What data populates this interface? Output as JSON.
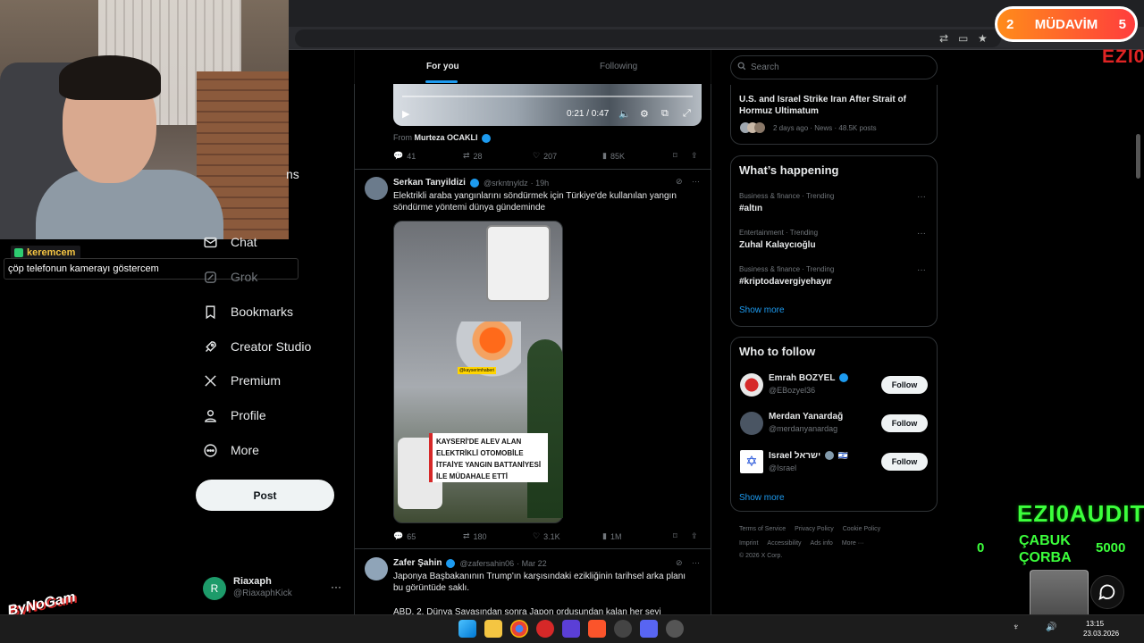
{
  "nav": {
    "partial_label": "ns",
    "items": [
      {
        "label": "Chat",
        "icon": "mail-icon",
        "muted": false
      },
      {
        "label": "Grok",
        "icon": "grok-icon",
        "muted": true
      },
      {
        "label": "Bookmarks",
        "icon": "bookmark-icon",
        "muted": false
      },
      {
        "label": "Creator Studio",
        "icon": "rocket-icon",
        "muted": false
      },
      {
        "label": "Premium",
        "icon": "x-logo-icon",
        "muted": false
      },
      {
        "label": "Profile",
        "icon": "person-icon",
        "muted": false
      },
      {
        "label": "More",
        "icon": "more-circle-icon",
        "muted": false
      }
    ],
    "post_button": "Post",
    "account": {
      "initial": "R",
      "name": "Riaxaph",
      "handle": "@RiaxaphKick",
      "more": "···"
    }
  },
  "chat_overlay": {
    "username": "keremcem",
    "message": "çöp telefonun kamerayı göstercem"
  },
  "feed": {
    "tabs": {
      "for_you": "For you",
      "following": "Following"
    },
    "video": {
      "time": "0:21 / 0:47"
    },
    "prev_tweet": {
      "from_label": "From",
      "from_name": "Murteza OCAKLI",
      "replies": "41",
      "reposts": "28",
      "likes": "207",
      "views": "85K"
    },
    "tweet1": {
      "name": "Serkan Tanyildizi",
      "handle": "@srkntnyldz",
      "time": "· 19h",
      "text": "Elektrikli araba yangınlarını söndürmek için Türkiye'de kullanılan yangın söndürme yöntemi dünya gündeminde",
      "media_tag": "@kayserimhaberi",
      "caption": [
        "KAYSERİ'DE ALEV ALAN",
        "ELEKTRİKLİ OTOMOBİLE",
        "İTFAİYE YANGIN BATTANİYESİ",
        "İLE MÜDAHALE ETTİ"
      ],
      "replies": "65",
      "reposts": "180",
      "likes": "3.1K",
      "views": "1M"
    },
    "tweet2": {
      "name": "Zafer Şahin",
      "handle": "@zafersahin06",
      "time": "· Mar 22",
      "text": "Japonya Başbakanının Trump'ın karşısındaki ezikliğinin tarihsel arka planı bu görüntüde saklı.",
      "text2": "ABD, 2. Dünya Savaşından sonra Japon ordusundan kalan her şeyi"
    }
  },
  "right": {
    "search_placeholder": "Search",
    "news": {
      "title": "U.S. and Israel Strike Iran After Strait of Hormuz Ultimatum",
      "meta": "2 days ago · News · 48.5K posts"
    },
    "happening": {
      "title": "What’s happening",
      "trends": [
        {
          "meta": "Business & finance · Trending",
          "name": "#altın"
        },
        {
          "meta": "Entertainment · Trending",
          "name": "Zuhal Kalaycıoğlu"
        },
        {
          "meta": "Business & finance · Trending",
          "name": "#kriptodavergiyehayır"
        }
      ],
      "more_dots": "···",
      "show_more": "Show more"
    },
    "follow": {
      "title": "Who to follow",
      "users": [
        {
          "name": "Emrah BOZYEL",
          "handle": "@EBozyel36",
          "button": "Follow"
        },
        {
          "name": "Merdan Yanardağ",
          "handle": "@merdanyanardag",
          "button": "Follow"
        },
        {
          "name": "Israel ישראל",
          "handle": "@Israel",
          "button": "Follow"
        }
      ],
      "show_more": "Show more"
    },
    "footer": {
      "row1": [
        "Terms of Service",
        "Privacy Policy",
        "Cookie Policy"
      ],
      "row2": [
        "Imprint",
        "Accessibility",
        "Ads info",
        "More ···"
      ],
      "copyright": "© 2026 X Corp."
    }
  },
  "overlays": {
    "rank": "2",
    "rank_label": "MÜDAVİM",
    "rank_count": "5",
    "ezio_top": "EZI0",
    "ezio": "EZI0AUDIT",
    "cabuk": "ÇABUK",
    "corba": "ÇORBA",
    "left_num": "0",
    "right_num": "5000",
    "logo": "ByNoGam"
  },
  "taskbar": {
    "time": "13:15",
    "date": "23.03.2026"
  },
  "colors": {
    "accent": "#1d9bf0",
    "background": "#000000",
    "border": "#2f3336",
    "muted_text": "#71767b"
  }
}
